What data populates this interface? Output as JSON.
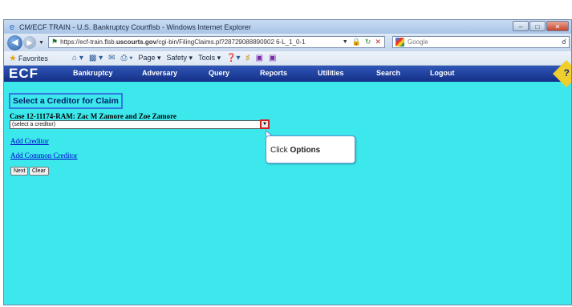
{
  "window": {
    "title": "CM/ECF TRAIN - U.S. Bankruptcy Courtflsb - Windows Internet Explorer",
    "minimize": "–",
    "maximize": "□",
    "close": "✕"
  },
  "addressbar": {
    "url_prefix": "https://ecf-train.flsb.",
    "url_domain": "uscourts.gov",
    "url_path": "/cgi-bin/FilingClaims.pl?28729088890902 6-L_1_0-1",
    "search_placeholder": "Google"
  },
  "commandbar": {
    "favorites": "Favorites",
    "page": "Page ▾",
    "safety": "Safety ▾",
    "tools": "Tools ▾"
  },
  "ecf_menu": {
    "logo": "ECF",
    "items": [
      "Bankruptcy",
      "Adversary",
      "Query",
      "Reports",
      "Utilities",
      "Search",
      "Logout"
    ]
  },
  "content": {
    "page_title": "Select a Creditor for Claim",
    "case_line": "Case 12-11174-RAM: Zac M Zamore and Zoe Zamore",
    "creditor_select_value": "(select a creditor)",
    "add_creditor": "Add Creditor",
    "add_common_creditor": "Add Common Creditor",
    "next_button": "Next",
    "clear_button": "Clear"
  },
  "callout": {
    "prefix": "Click ",
    "emphasis": "Options"
  }
}
